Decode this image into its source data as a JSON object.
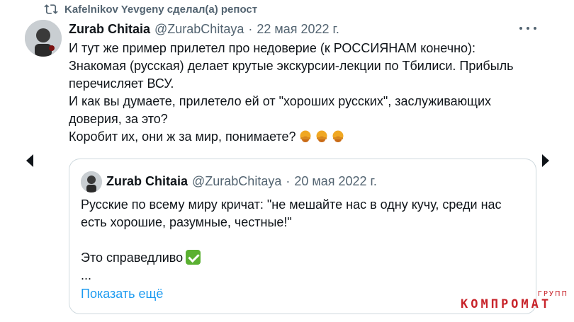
{
  "repost": {
    "icon": "repost-icon",
    "text": "Kafelnikov Yevgeny сделал(а) репост"
  },
  "tweet": {
    "author_name": "Zurab Chitaia",
    "handle": "@ZurabChitaya",
    "separator": "·",
    "date": "22 мая 2022 г.",
    "more_icon": "more-icon",
    "lines": [
      "И тут же пример прилетел про недоверие (к РОССИЯНАМ конечно):",
      "Знакомая (русская) делает крутые экскурсии-лекции по Тбилиси. Прибыль",
      "перечисляет ВСУ.",
      "И как вы думаете, прилетело ей от \"хороших русских\", заслуживающих",
      "доверия, за это?",
      "Коробит их, они ж за мир, понимаете?"
    ],
    "emoji": [
      "vomiting-face-emoji",
      "vomiting-face-emoji",
      "vomiting-face-emoji"
    ]
  },
  "quote": {
    "author_name": "Zurab Chitaia",
    "handle": "@ZurabChitaya",
    "separator": "·",
    "date": "20 мая 2022 г.",
    "lines": [
      "Русские по всему миру кричат: \"не мешайте нас в одну кучу, среди нас",
      "есть хорошие, разумные, честные!\""
    ],
    "last_line": "Это справедливо",
    "check_icon": "check-mark-emoji",
    "ellipsis": "...",
    "show_more": "Показать ещё"
  },
  "navigation": {
    "prev_icon": "chevron-left-icon",
    "next_icon": "chevron-right-icon"
  },
  "watermark": {
    "main": "КОМПРОМАТ",
    "sub": "ГРУПП"
  },
  "colors": {
    "text": "#0f1419",
    "secondary": "#536471",
    "link": "#1d9bf0",
    "border": "#cfd9de",
    "watermark": "#c8242b",
    "check": "#5ab031"
  }
}
